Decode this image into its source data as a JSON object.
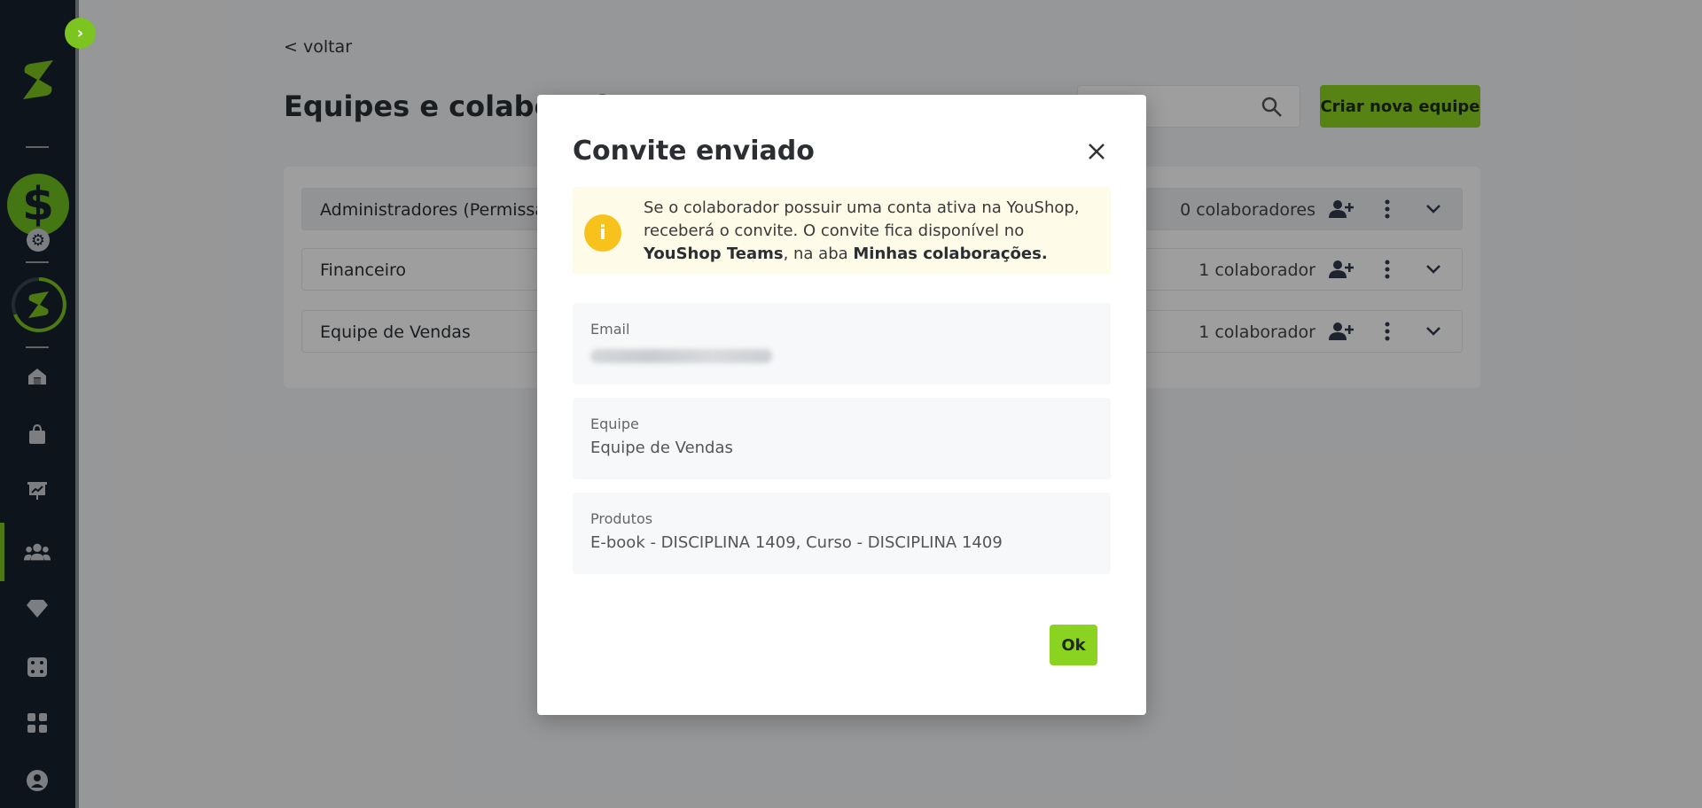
{
  "sidebar": {
    "toggle_glyph": "›",
    "dollar_glyph": "$",
    "gear_glyph": "⚙",
    "icons": [
      "home-icon",
      "shopping-bag-icon",
      "presentation-chart-icon",
      "users-icon",
      "diamond-icon",
      "dice-icon",
      "apps-grid-icon",
      "user-profile-icon"
    ]
  },
  "page": {
    "back_label": "< voltar",
    "title": "Equipes e colaboradores",
    "create_button": "Criar nova equipe",
    "teams": [
      {
        "name": "Administradores (Permissão total)",
        "count": "0 colaboradores"
      },
      {
        "name": "Financeiro",
        "count": "1 colaborador"
      },
      {
        "name": "Equipe de Vendas",
        "count": "1 colaborador"
      }
    ]
  },
  "modal": {
    "title": "Convite enviado",
    "alert": {
      "part1": "Se o colaborador possuir uma conta ativa na YouShop, receberá o convite. O convite fica disponível no ",
      "bold1": "YouShop Teams",
      "part2": ", na aba ",
      "bold2": "Minhas colaborações."
    },
    "fields": {
      "email_label": "Email",
      "team_label": "Equipe",
      "team_value": "Equipe de Vendas",
      "products_label": "Produtos",
      "products_value": "E-book - DISCIPLINA 1409, Curso - DISCIPLINA 1409"
    },
    "ok_button": "Ok"
  },
  "colors": {
    "accent": "#8bd321",
    "sidebar": "#17212e",
    "alert_bg": "#fefbe8",
    "alert_icon": "#f6c21b"
  }
}
